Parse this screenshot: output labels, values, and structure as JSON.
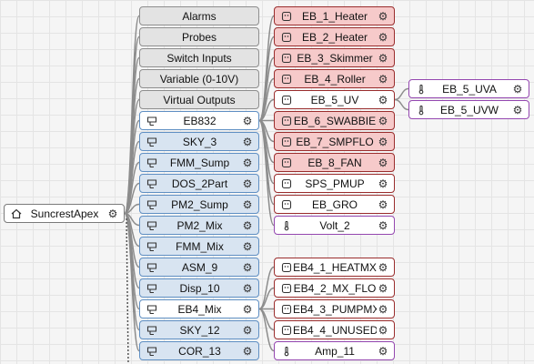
{
  "root": {
    "label": "SuncrestApex",
    "icon": "home-icon"
  },
  "categories": [
    {
      "label": "Alarms"
    },
    {
      "label": "Probes"
    },
    {
      "label": "Switch Inputs"
    },
    {
      "label": "Variable (0-10V)"
    },
    {
      "label": "Virtual Outputs"
    }
  ],
  "modules": [
    {
      "label": "EB832",
      "icon": "module-icon"
    },
    {
      "label": "SKY_3",
      "icon": "module-icon"
    },
    {
      "label": "FMM_Sump",
      "icon": "module-icon"
    },
    {
      "label": "DOS_2Part",
      "icon": "module-icon"
    },
    {
      "label": "PM2_Sump",
      "icon": "module-icon"
    },
    {
      "label": "PM2_Mix",
      "icon": "module-icon"
    },
    {
      "label": "FMM_Mix",
      "icon": "module-icon"
    },
    {
      "label": "ASM_9",
      "icon": "module-icon"
    },
    {
      "label": "Disp_10",
      "icon": "module-icon"
    },
    {
      "label": "EB4_Mix",
      "icon": "module-icon"
    },
    {
      "label": "SKY_12",
      "icon": "module-icon"
    },
    {
      "label": "COR_13",
      "icon": "module-icon"
    }
  ],
  "outputs": [
    {
      "label": "EB_1_Heater",
      "kind": "outlet",
      "state": "on"
    },
    {
      "label": "EB_2_Heater",
      "kind": "outlet",
      "state": "on"
    },
    {
      "label": "EB_3_Skimmer",
      "kind": "outlet",
      "state": "on"
    },
    {
      "label": "EB_4_Roller",
      "kind": "outlet",
      "state": "on"
    },
    {
      "label": "EB_5_UV",
      "kind": "outlet",
      "state": "off"
    },
    {
      "label": "EB_6_SWABBIE",
      "kind": "outlet",
      "state": "on"
    },
    {
      "label": "EB_7_SMPFLO",
      "kind": "outlet",
      "state": "on"
    },
    {
      "label": "EB_8_FAN",
      "kind": "outlet",
      "state": "on"
    },
    {
      "label": "SPS_PMUP",
      "kind": "outlet",
      "state": "off"
    },
    {
      "label": "EB_GRO",
      "kind": "outlet",
      "state": "off"
    },
    {
      "label": "Volt_2",
      "kind": "probe",
      "state": "off"
    },
    {
      "label": "EB4_1_HEATMX",
      "kind": "outlet",
      "state": "off"
    },
    {
      "label": "EB4_2_MX_FLO",
      "kind": "outlet",
      "state": "off"
    },
    {
      "label": "EB4_3_PUMPMX",
      "kind": "outlet",
      "state": "off"
    },
    {
      "label": "EB4_4_UNUSED",
      "kind": "outlet",
      "state": "off"
    },
    {
      "label": "Amp_11",
      "kind": "probe",
      "state": "off"
    }
  ],
  "probes": [
    {
      "label": "EB_5_UVA",
      "icon": "thermometer-icon"
    },
    {
      "label": "EB_5_UVW",
      "icon": "thermometer-icon"
    }
  ],
  "colors": {
    "module_border": "#5f8fc3",
    "module_fill": "#d8e4f1",
    "outlet_border": "#9a2d2d",
    "outlet_on_fill": "#f6caca",
    "probe_border": "#9447b0",
    "wire": "#8c8c8c"
  }
}
